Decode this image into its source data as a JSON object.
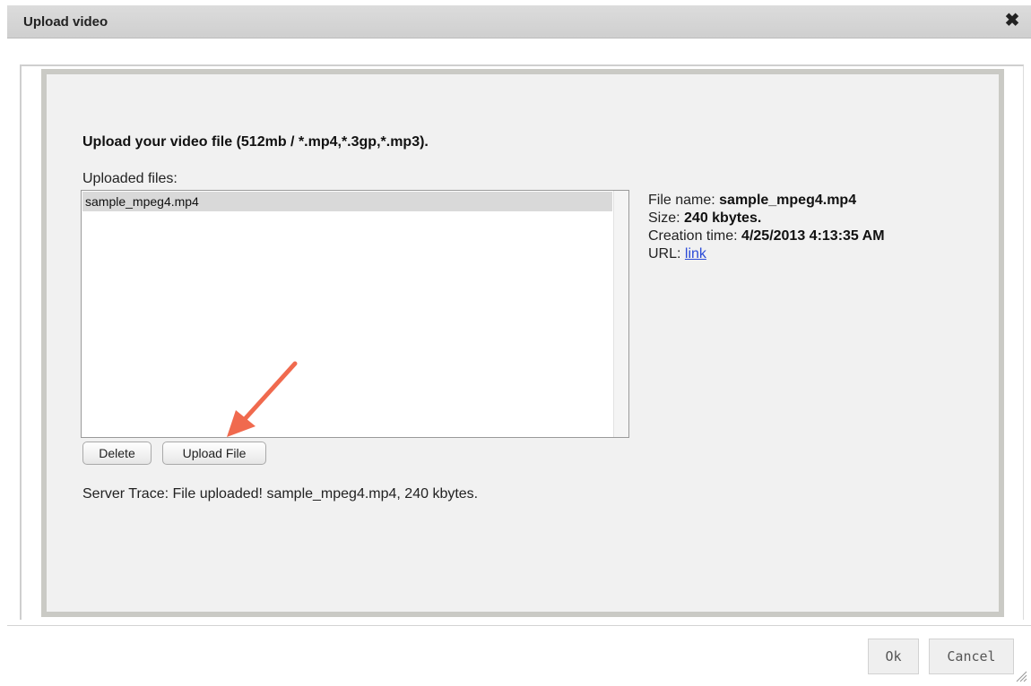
{
  "dialog": {
    "title": "Upload video",
    "close_glyph": "✖"
  },
  "panel": {
    "heading": "Upload your video file (512mb / *.mp4,*.3gp,*.mp3).",
    "uploaded_label": "Uploaded files:",
    "files": [
      "sample_mpeg4.mp4"
    ],
    "delete_label": "Delete",
    "upload_label": "Upload File",
    "trace": "Server Trace: File uploaded! sample_mpeg4.mp4, 240 kbytes."
  },
  "info": {
    "name_label": "File name: ",
    "name_value": "sample_mpeg4.mp4",
    "size_label": "Size: ",
    "size_value": "240 kbytes.",
    "ctime_label": "Creation time: ",
    "ctime_value": "4/25/2013 4:13:35 AM",
    "url_label": "URL: ",
    "url_link": "link"
  },
  "footer": {
    "ok_label": "Ok",
    "cancel_label": "Cancel"
  },
  "colors": {
    "arrow": "#f06a4e",
    "link": "#2a4bd7"
  }
}
